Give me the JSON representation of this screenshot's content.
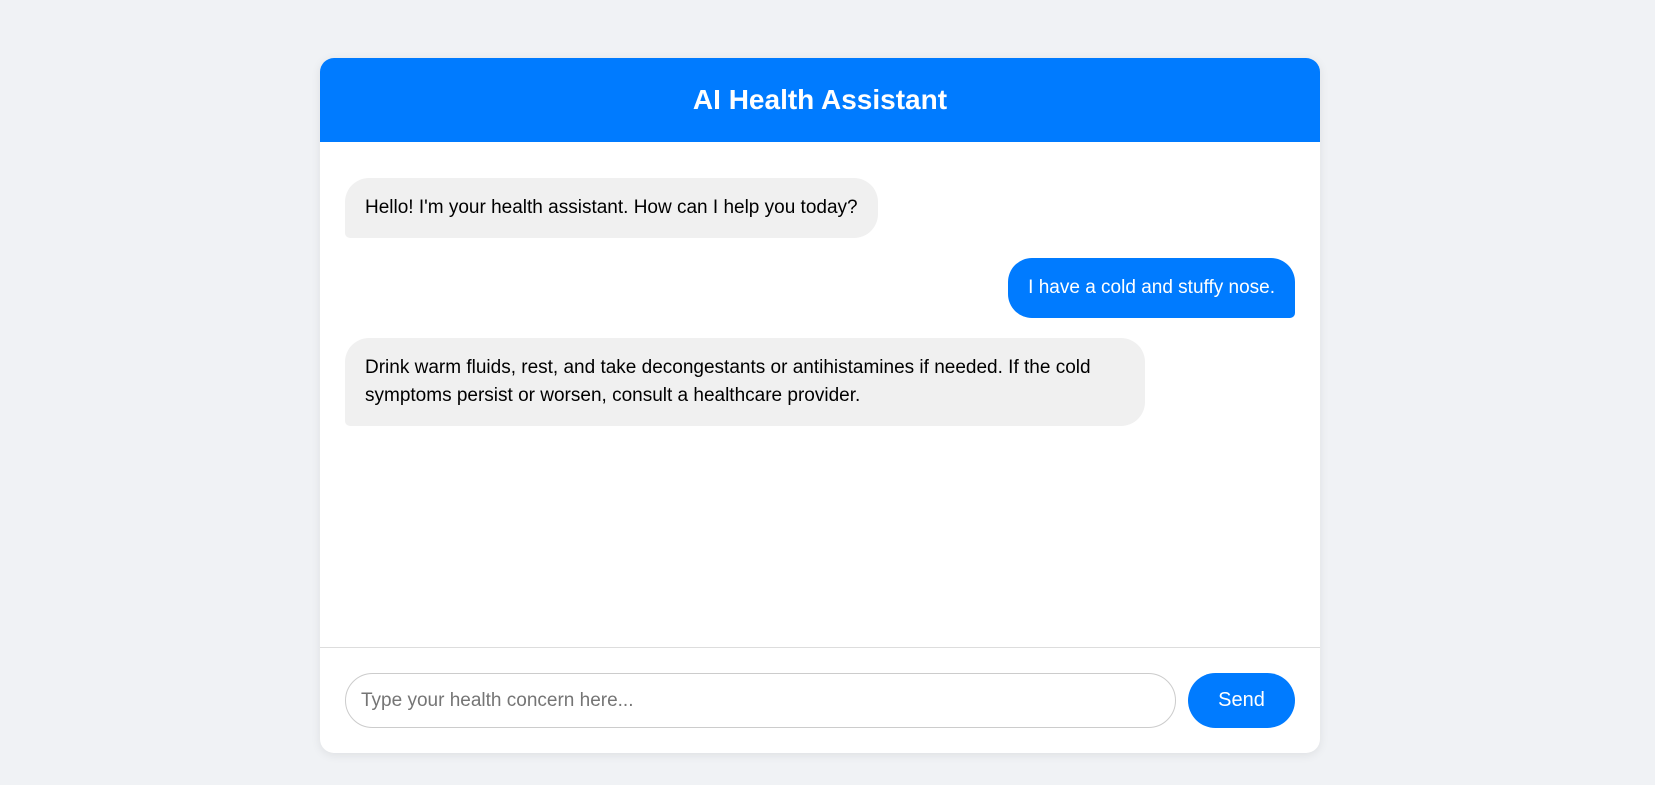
{
  "header": {
    "title": "AI Health Assistant"
  },
  "messages": [
    {
      "sender": "bot",
      "text": "Hello! I'm your health assistant. How can I help you today?"
    },
    {
      "sender": "user",
      "text": "I have a cold and stuffy nose."
    },
    {
      "sender": "bot",
      "text": "Drink warm fluids, rest, and take decongestants or antihistamines if needed. If the cold symptoms persist or worsen, consult a healthcare provider."
    }
  ],
  "input": {
    "value": "",
    "placeholder": "Type your health concern here..."
  },
  "send_button": {
    "label": "Send"
  },
  "colors": {
    "accent": "#007bff",
    "background": "#f0f2f5",
    "bot_bubble": "#f0f0f0"
  }
}
